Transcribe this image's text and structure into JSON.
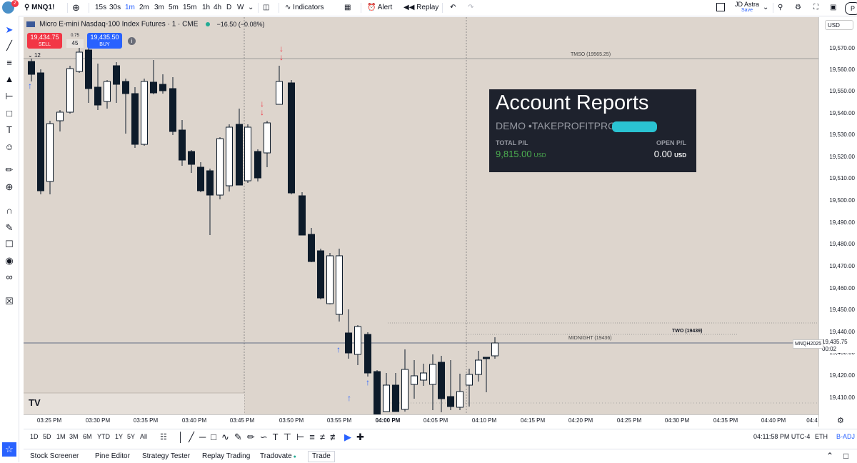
{
  "topbar": {
    "symbol": "MNQ1!",
    "notification_count": "2",
    "intervals": [
      "15s",
      "30s",
      "1m",
      "2m",
      "3m",
      "5m",
      "15m",
      "1h",
      "4h",
      "D",
      "W"
    ],
    "active_interval": "1m",
    "indicators_label": "Indicators",
    "alert_label": "Alert",
    "replay_label": "Replay",
    "user_name": "JD Astra",
    "save_label": "Save"
  },
  "legend": {
    "title": "Micro E-mini Nasdaq-100 Index Futures · 1 · CME",
    "change": "−16.50 (−0.08%)",
    "sell_price": "19,434.75",
    "sell_label": "SELL",
    "spread": "0.75",
    "spread_count": "45",
    "buy_price": "19,435.50",
    "buy_label": "BUY",
    "indicator_count": "12"
  },
  "currency": "USD",
  "price_axis": {
    "ticks": [
      "19,570.00",
      "19,560.00",
      "19,550.00",
      "19,540.00",
      "19,530.00",
      "19,520.00",
      "19,510.00",
      "19,500.00",
      "19,490.00",
      "19,480.00",
      "19,470.00",
      "19,460.00",
      "19,450.00",
      "19,440.00",
      "19,430.00",
      "19,420.00",
      "19,410.00"
    ],
    "current_symbol": "MNQH2025",
    "current_price": "19,435.75",
    "countdown": "00:02"
  },
  "time_axis": {
    "ticks": [
      "03:25 PM",
      "03:30 PM",
      "03:35 PM",
      "03:40 PM",
      "03:45 PM",
      "03:50 PM",
      "03:55 PM",
      "04:00 PM",
      "04:05 PM",
      "04:10 PM",
      "04:15 PM",
      "04:20 PM",
      "04:25 PM",
      "04:30 PM",
      "04:35 PM",
      "04:40 PM",
      "04:4"
    ]
  },
  "levels": {
    "tmso": "TMSO (19565.25)",
    "midnight": "MIDNIGHT (19436)",
    "two": "TWO (19439)"
  },
  "report": {
    "title": "Account Reports",
    "account": "DEMO •TAKEPROFITPRO",
    "total_pl_label": "TOTAL P/L",
    "total_pl_value": "9,815.00",
    "total_pl_currency": "USD",
    "open_pl_label": "OPEN P/L",
    "open_pl_value": "0.00",
    "open_pl_currency": "USD"
  },
  "rangebar": {
    "ranges": [
      "1D",
      "5D",
      "1M",
      "3M",
      "6M",
      "YTD",
      "1Y",
      "5Y",
      "All"
    ],
    "clock": "04:11:58 PM UTC-4",
    "session": "ETH",
    "adjust": "B-ADJ"
  },
  "panelbar": {
    "tabs": [
      "Stock Screener",
      "Pine Editor",
      "Strategy Tester",
      "Replay Trading",
      "Tradovate",
      "Trade"
    ]
  },
  "colors": {
    "chart_bg": "#ddd5cd",
    "down_candle": "#0d1b2a",
    "up_candle": "#ffffff",
    "accent": "#2962ff",
    "profit_green": "#4caf50",
    "sell_red": "#f23645"
  }
}
